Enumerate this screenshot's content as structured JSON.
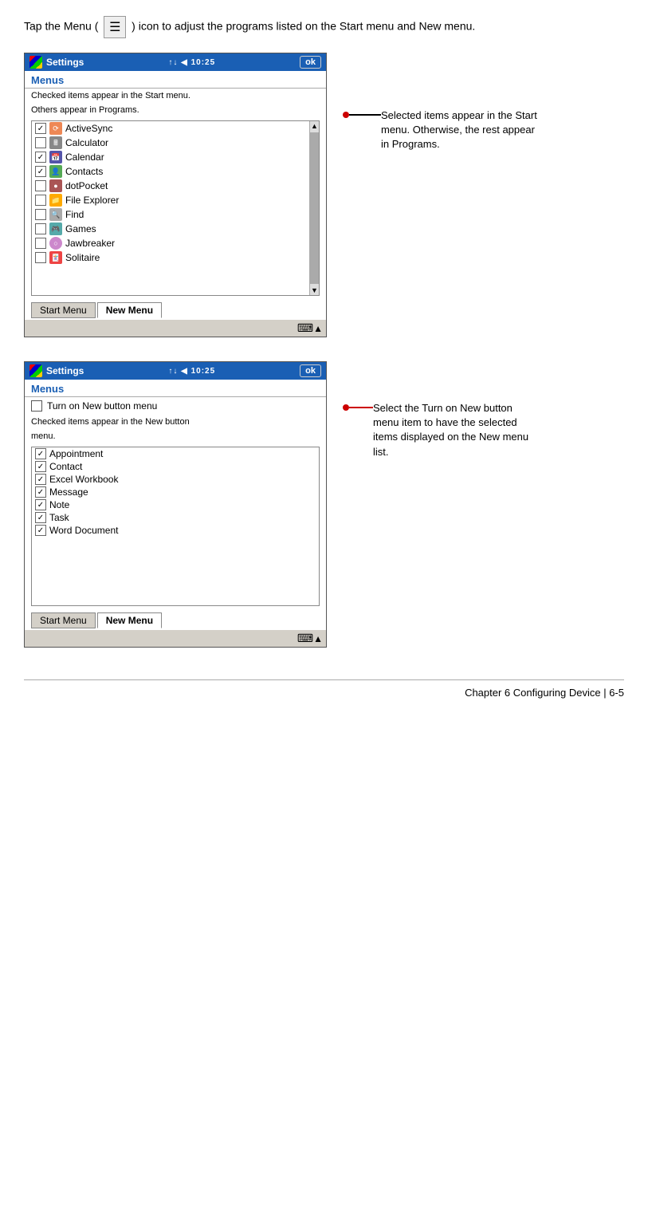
{
  "page": {
    "intro": {
      "text_before": "Tap the Menu (",
      "text_after": ") icon to adjust the programs listed on the Start menu and New menu.",
      "menu_icon_symbol": "☰"
    },
    "screenshot1": {
      "titlebar": {
        "app": "Settings",
        "signal": "↑↓ ◀ 10:25",
        "ok": "ok"
      },
      "section_header": "Menus",
      "subtitle1": "Checked items appear in the Start menu.",
      "subtitle2": "Others appear in Programs.",
      "items": [
        {
          "label": "ActiveSync",
          "checked": true
        },
        {
          "label": "Calculator",
          "checked": false
        },
        {
          "label": "Calendar",
          "checked": true
        },
        {
          "label": "Contacts",
          "checked": true
        },
        {
          "label": "dotPocket",
          "checked": false
        },
        {
          "label": "File Explorer",
          "checked": false
        },
        {
          "label": "Find",
          "checked": false
        },
        {
          "label": "Games",
          "checked": false
        },
        {
          "label": "Jawbreaker",
          "checked": false
        },
        {
          "label": "Solitaire",
          "checked": false
        }
      ],
      "tabs": [
        "Start Menu",
        "New Menu"
      ],
      "active_tab_index": 0,
      "annotation": "Selected items appear in the Start menu. Otherwise, the rest appear in Programs."
    },
    "screenshot2": {
      "titlebar": {
        "app": "Settings",
        "signal": "↑↓ ◀ 10:25",
        "ok": "ok"
      },
      "section_header": "Menus",
      "turn_on_label": "Turn on New button menu",
      "subtitle1": "Checked items appear in the New button menu.",
      "items": [
        {
          "label": "Appointment",
          "checked": true
        },
        {
          "label": "Contact",
          "checked": true
        },
        {
          "label": "Excel Workbook",
          "checked": true
        },
        {
          "label": "Message",
          "checked": true
        },
        {
          "label": "Note",
          "checked": true
        },
        {
          "label": "Task",
          "checked": true
        },
        {
          "label": "Word Document",
          "checked": true
        }
      ],
      "tabs": [
        "Start Menu",
        "New Menu"
      ],
      "active_tab_index": 1,
      "annotation": "Select the Turn on New button menu item to have the selected items displayed on the New menu list."
    },
    "footer": "Chapter 6 Configuring Device  |  6-5"
  }
}
